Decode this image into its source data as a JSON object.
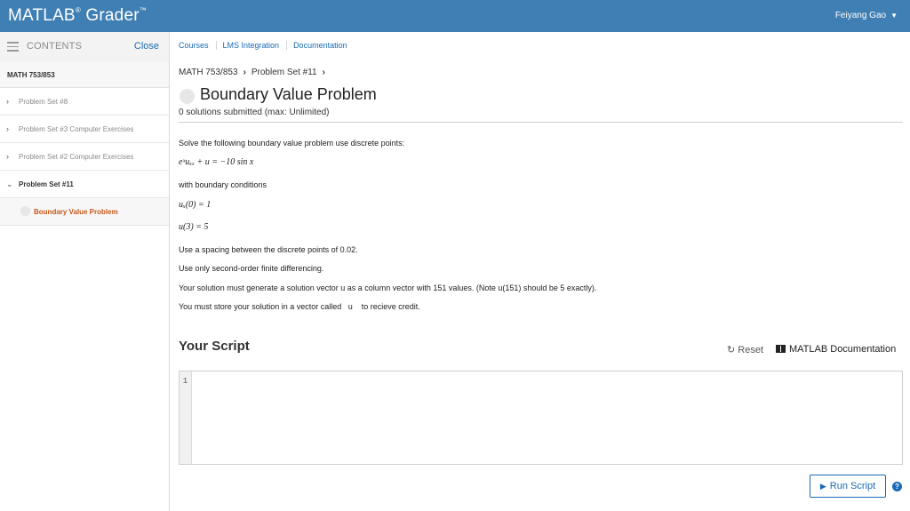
{
  "app": {
    "brand": "MATLAB",
    "brand_reg": "®",
    "brand_sub": "Grader",
    "brand_tm": "™"
  },
  "user": {
    "name": "Feiyang Gao"
  },
  "sidebar": {
    "contents_label": "CONTENTS",
    "close_label": "Close",
    "course": "MATH 753/853",
    "items": [
      {
        "label": "Problem Set #8"
      },
      {
        "label": "Problem Set #3 Computer Exercises"
      },
      {
        "label": "Problem Set #2 Computer Exercises"
      },
      {
        "label": "Problem Set #11"
      }
    ],
    "active_sub": "Boundary Value Problem"
  },
  "nav": {
    "links": [
      "Courses",
      "LMS Integration",
      "Documentation"
    ]
  },
  "breadcrumb": {
    "course": "MATH 753/853",
    "set": "Problem Set #11"
  },
  "problem": {
    "title": "Boundary Value Problem",
    "submissions": "0 solutions submitted (max: Unlimited)",
    "intro": "Solve the following boundary value problem use discrete points:",
    "equation": "eˣuₓₓ + u = −10 sin x",
    "bc_intro": "with boundary conditions",
    "bc1": "uₓ(0) = 1",
    "bc2": "u(3) = 5",
    "line1": "Use a spacing between the discrete points of 0.02.",
    "line2": "Use only second-order finite differencing.",
    "line3": "Your solution must generate a solution vector u as a column vector with 151 values. (Note u(151) should be 5 exactly).",
    "line4": "You must store your solution in a vector called   u    to recieve credit."
  },
  "script": {
    "title": "Your Script",
    "reset_label": "Reset",
    "doc_label": "MATLAB Documentation",
    "line_number": "1",
    "run_label": "Run Script"
  },
  "colors": {
    "topbar": "#3f7fb3",
    "link": "#1a6bb5",
    "active": "#c8581a"
  }
}
